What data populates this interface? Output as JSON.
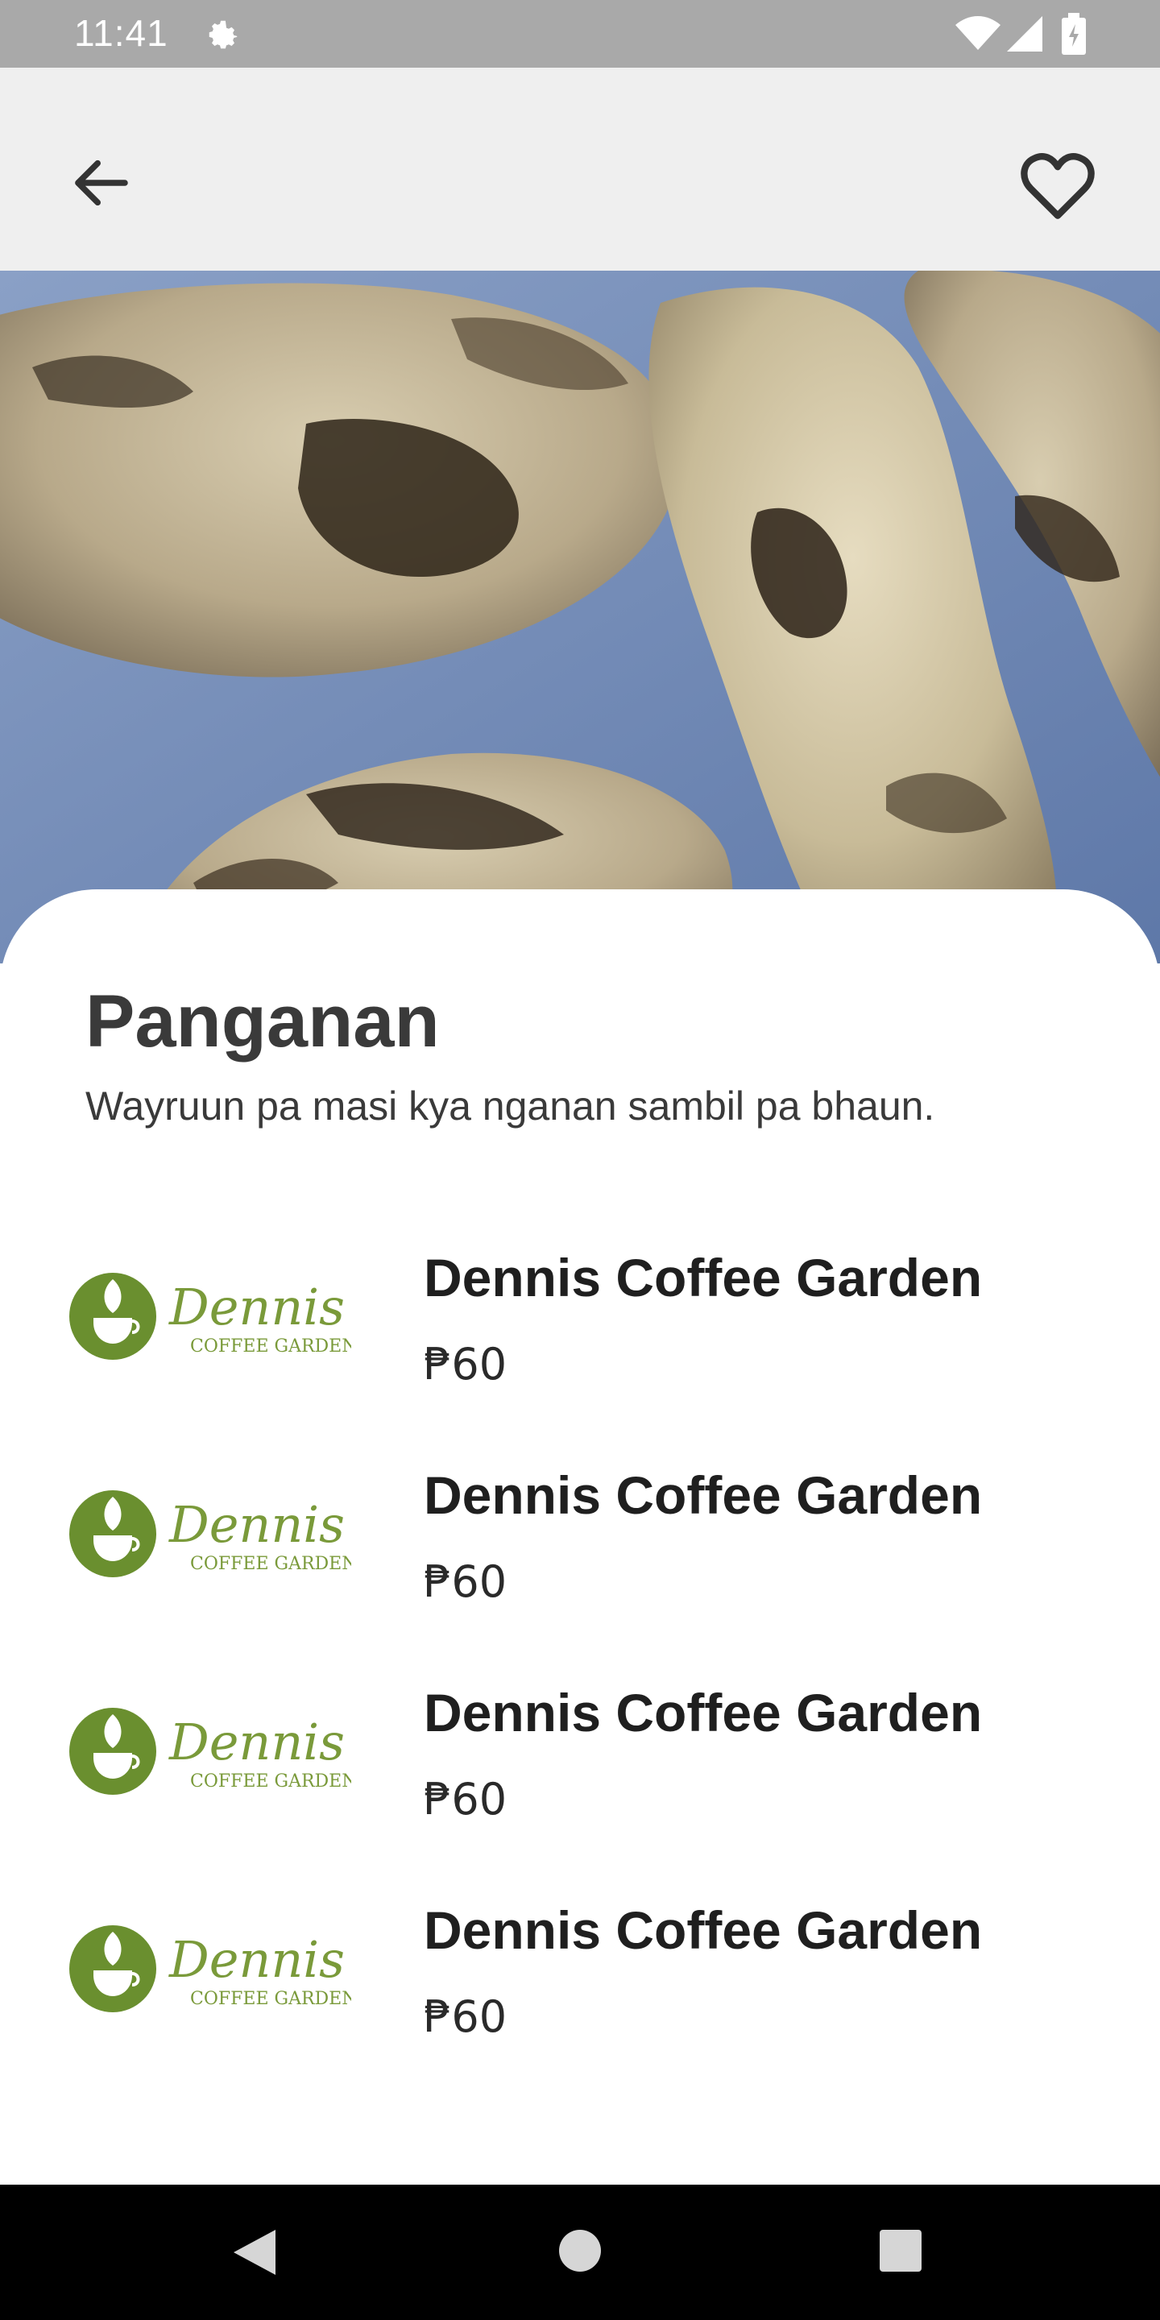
{
  "status_bar": {
    "time": "11:41",
    "icons": [
      "gear-icon",
      "wifi-icon",
      "signal-icon",
      "battery-icon"
    ]
  },
  "app_bar": {
    "back_icon": "arrow-left-icon",
    "favorite_icon": "heart-outline-icon"
  },
  "hero": {
    "image": "fried-snack-photo"
  },
  "content": {
    "title": "Panganan",
    "subtitle": "Wayruun pa masi kya nganan sambil pa bhaun."
  },
  "shops": [
    {
      "name": "Dennis Coffee Garden",
      "price": "₱60",
      "logo_text": "Dennis",
      "logo_subtext": "COFFEE GARDEN"
    },
    {
      "name": "Dennis Coffee Garden",
      "price": "₱60",
      "logo_text": "Dennis",
      "logo_subtext": "COFFEE GARDEN"
    },
    {
      "name": "Dennis Coffee Garden",
      "price": "₱60",
      "logo_text": "Dennis",
      "logo_subtext": "COFFEE GARDEN"
    },
    {
      "name": "Dennis Coffee Garden",
      "price": "₱60",
      "logo_text": "Dennis",
      "logo_subtext": "COFFEE GARDEN"
    }
  ],
  "colors": {
    "status_bar": "#a9a9a9",
    "app_bar": "#efefef",
    "brand_green": "#6a8f2f",
    "text_dark": "#3a3a3a",
    "nav_bar": "#000000"
  },
  "nav_bar": {
    "icons": [
      "triangle-back-icon",
      "circle-home-icon",
      "square-recents-icon"
    ]
  }
}
